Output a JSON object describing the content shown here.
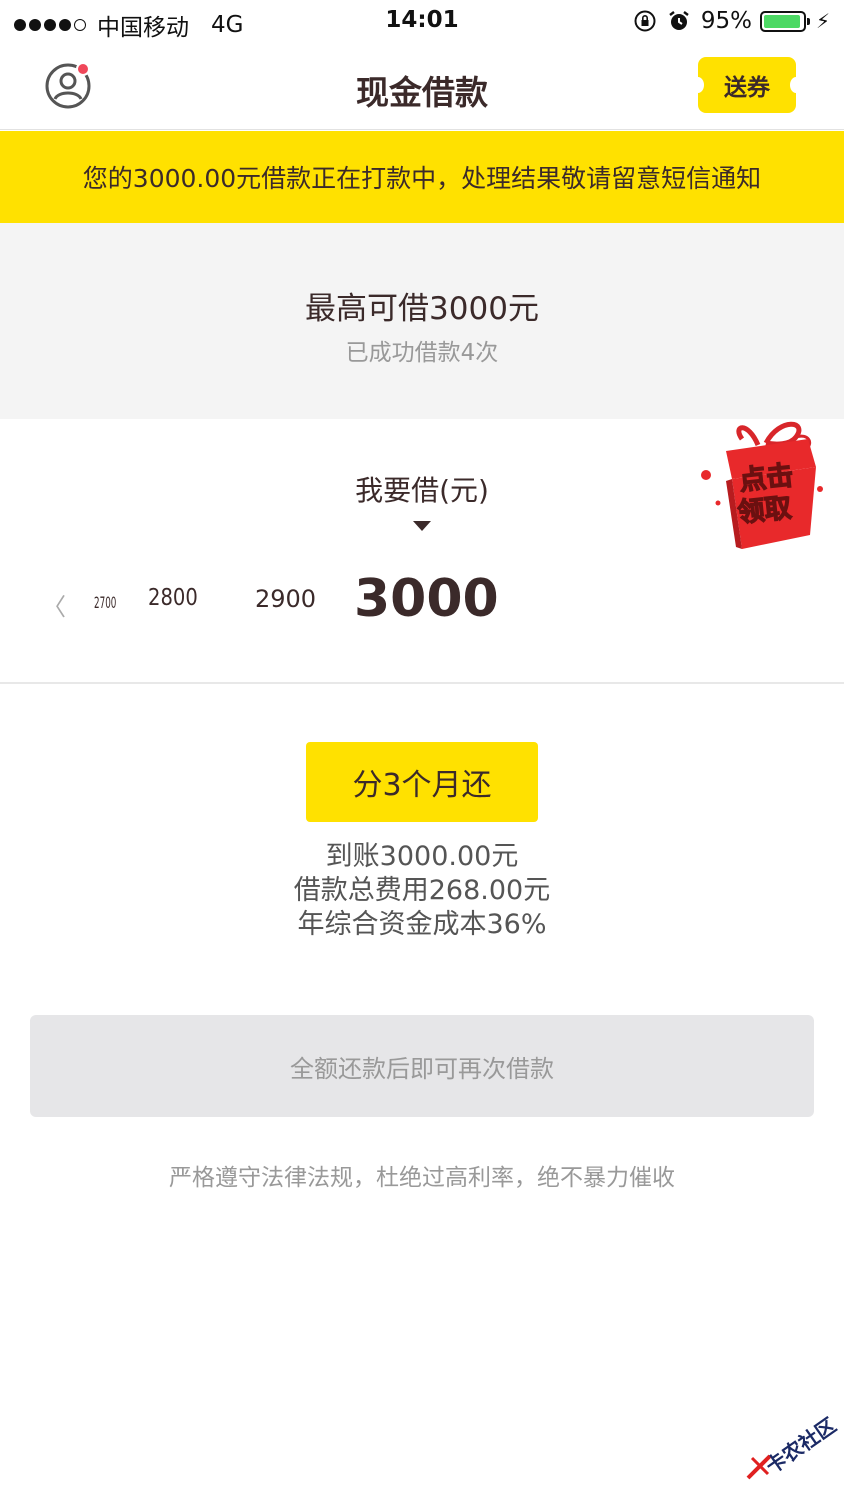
{
  "status_bar": {
    "carrier": "中国移动",
    "network": "4G",
    "time": "14:01",
    "battery": "95%",
    "battery_level": 0.95,
    "battery_color": "#4cd964"
  },
  "nav": {
    "title": "现金借款",
    "coupon_label": "送券",
    "avatar_icon": "user-avatar-icon"
  },
  "notice": {
    "text": "您的3000.00元借款正在打款中，处理结果敬请留意短信通知"
  },
  "limit": {
    "title": "最高可借3000元",
    "subtitle": "已成功借款4次"
  },
  "selector": {
    "label": "我要借(元)",
    "ticks": [
      "2700",
      "2800",
      "2900"
    ],
    "selected": "3000"
  },
  "gift": {
    "text_line1": "点击",
    "text_line2": "领取"
  },
  "plan": {
    "button_label": "分3个月还",
    "details": [
      "到账3000.00元",
      "借款总费用268.00元",
      "年综合资金成本36%"
    ]
  },
  "repay": {
    "label": "全额还款后即可再次借款"
  },
  "legal": {
    "text": "严格遵守法律法规，杜绝过高利率，绝不暴力催收"
  },
  "watermark": {
    "text": "卡农社区"
  },
  "colors": {
    "accent": "#ffe100",
    "text_dark": "#3b2a2a",
    "muted": "#999999",
    "notification_dot": "#f0475a"
  }
}
